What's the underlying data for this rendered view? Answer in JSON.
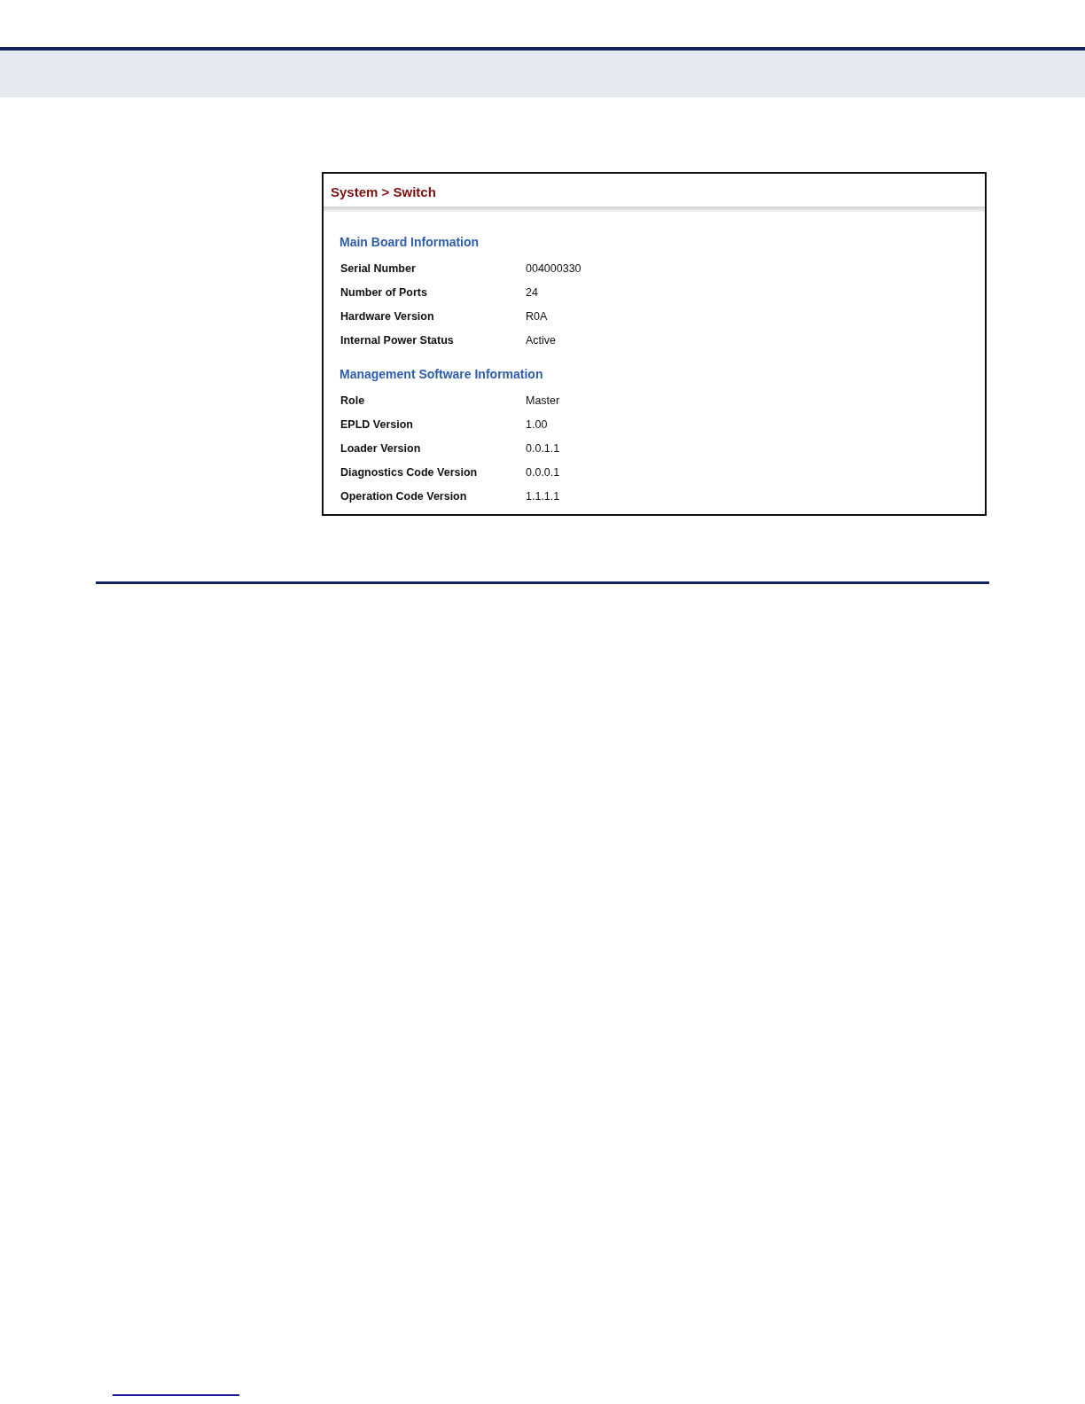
{
  "panel": {
    "breadcrumb": "System > Switch",
    "sections": [
      {
        "title": "Main Board Information",
        "rows": [
          {
            "label": "Serial Number",
            "value": "004000330"
          },
          {
            "label": "Number of Ports",
            "value": "24"
          },
          {
            "label": "Hardware Version",
            "value": "R0A"
          },
          {
            "label": "Internal Power Status",
            "value": "Active"
          }
        ]
      },
      {
        "title": "Management Software Information",
        "rows": [
          {
            "label": "Role",
            "value": "Master"
          },
          {
            "label": "EPLD Version",
            "value": "1.00"
          },
          {
            "label": "Loader Version",
            "value": "0.0.1.1"
          },
          {
            "label": "Diagnostics Code Version",
            "value": "0.0.0.1"
          },
          {
            "label": "Operation Code Version",
            "value": "1.1.1.1"
          }
        ]
      }
    ]
  }
}
